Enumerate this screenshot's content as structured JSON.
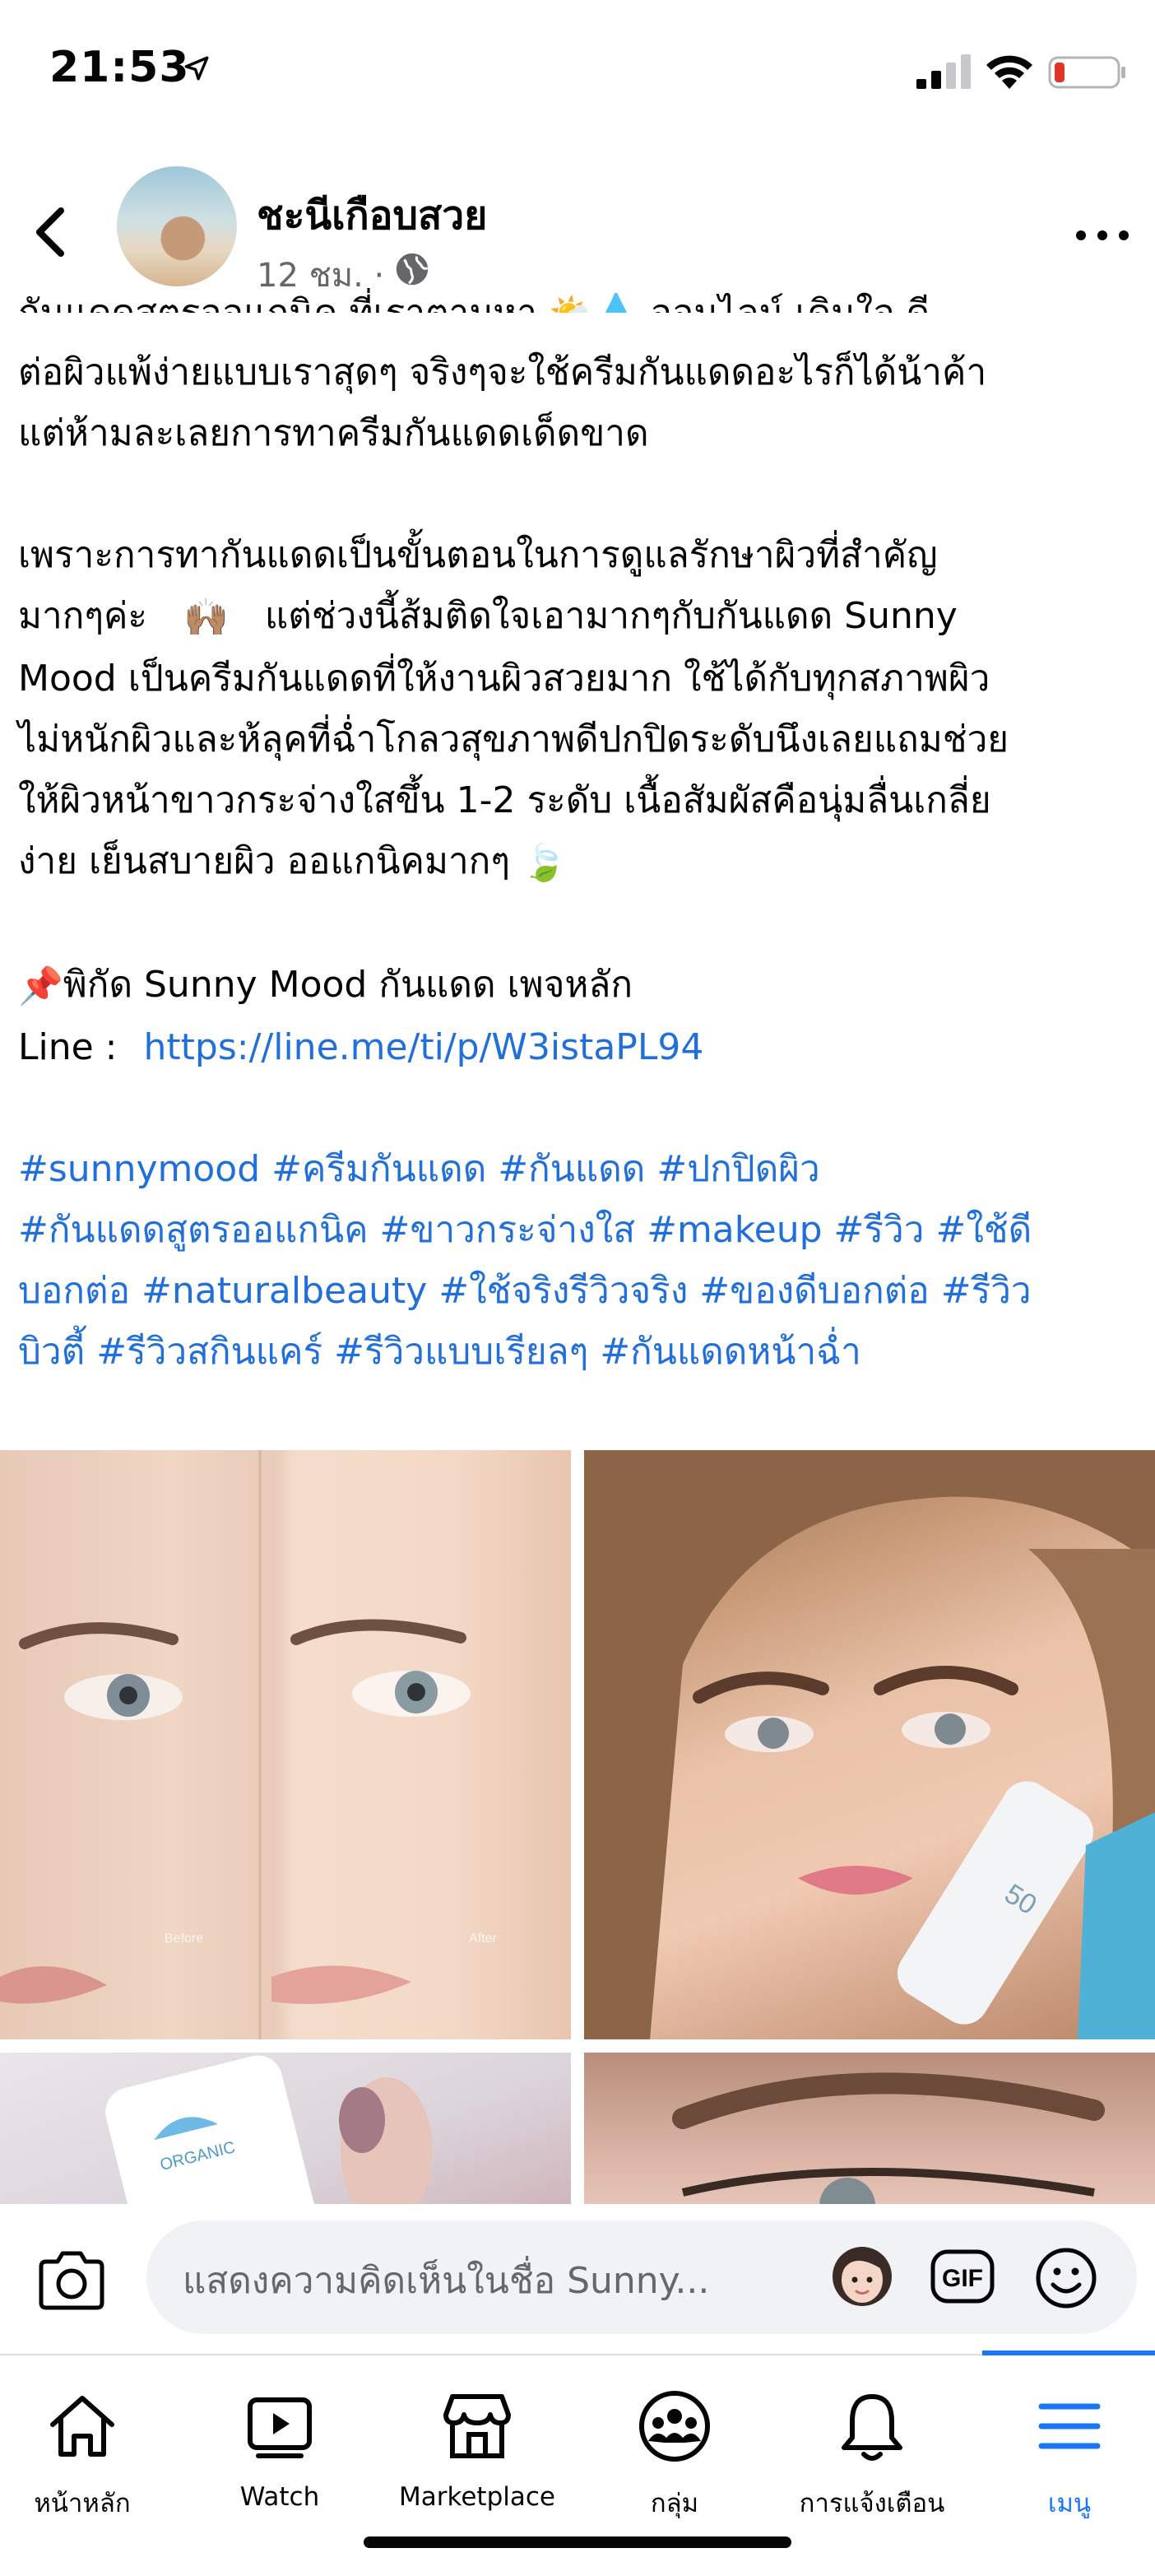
{
  "status_bar": {
    "time": "21:53"
  },
  "header": {
    "author": "ชะนีเกือบสวย",
    "meta": "12 ชม. ·"
  },
  "post": {
    "cut_line": "กันแดดสูตรออแกนิค ที่เราตามหา 🌤️💧 ออนไลน์ เดินใจ ดี",
    "lines_p1": [
      "ต่อผิวแพ้ง่ายแบบเราสุดๆ จริงๆจะใช้ครีมกันแดดอะไรก็ได้น้าค้า",
      "แต่ห้ามละเลยการทาครีมกันแดดเด็ดขาด"
    ],
    "p2_line1": "เพราะการทากันแดดเป็นขั้นตอนในการดูแลรักษาผิวที่สำคัญ",
    "p2_line2_before": "มากๆค่ะ",
    "p2_line2_emoji": "🙌🏽",
    "p2_line2_after": "แต่ช่วงนี้ส้มติดใจเอามากๆกับกันแดด Sunny",
    "p2_lines_rest": [
      "Mood เป็นครีมกันแดดที่ให้งานผิวสวยมาก ใช้ได้กับทุกสภาพผิว",
      "ไม่หนักผิวและห้ลุคที่ฉ่ำโกลวสุขภาพดีปกปิดระดับนึงเลยแถมช่วย",
      "ให้ผิวหน้าขาวกระจ่างใสขึ้น 1-2 ระดับ เนื้อสัมผัสคือนุ่มลื่นเกลี่ย"
    ],
    "p2_last_line": "ง่าย เย็นสบายผิว ออแกนิคมากๆ",
    "p2_last_emoji": "🍃",
    "location_emoji": "📌",
    "location_text": "พิกัด Sunny Mood กันแดด เพจหลัก",
    "line_label": "Line :",
    "line_url": "https://line.me/ti/p/W3istaPL94",
    "hashtag_lines": [
      "#sunnymood #ครีมกันแดด #กันแดด #ปกปิดผิว",
      "#กันแดดสูตรออแกนิค #ขาวกระจ่างใส #makeup #รีวิว #ใช้ดี",
      "บอกต่อ #naturalbeauty #ใช้จริงรีวิวจริง #ของดีบอกต่อ #รีวิว",
      "บิวตี้ #รีวิวสกินแคร์ #รีวิวแบบเรียลๆ #กันแดดหน้าฉ่ำ"
    ]
  },
  "photos": {
    "before_label": "Before",
    "after_label": "After",
    "tube_text": "ORGANIC",
    "tube_number": "50"
  },
  "comment_bar": {
    "placeholder": "แสดงความคิดเห็นในชื่อ Sunny..."
  },
  "tabs": [
    {
      "label": "หน้าหลัก",
      "icon": "home-icon"
    },
    {
      "label": "Watch",
      "icon": "watch-icon"
    },
    {
      "label": "Marketplace",
      "icon": "marketplace-icon"
    },
    {
      "label": "กลุ่ม",
      "icon": "groups-icon"
    },
    {
      "label": "การแจ้งเตือน",
      "icon": "bell-icon"
    },
    {
      "label": "เมนู",
      "icon": "menu-icon"
    }
  ],
  "colors": {
    "link": "#216fdb",
    "active_tab": "#1877f2",
    "meta_text": "#65676b",
    "battery_low": "#e0352b"
  }
}
